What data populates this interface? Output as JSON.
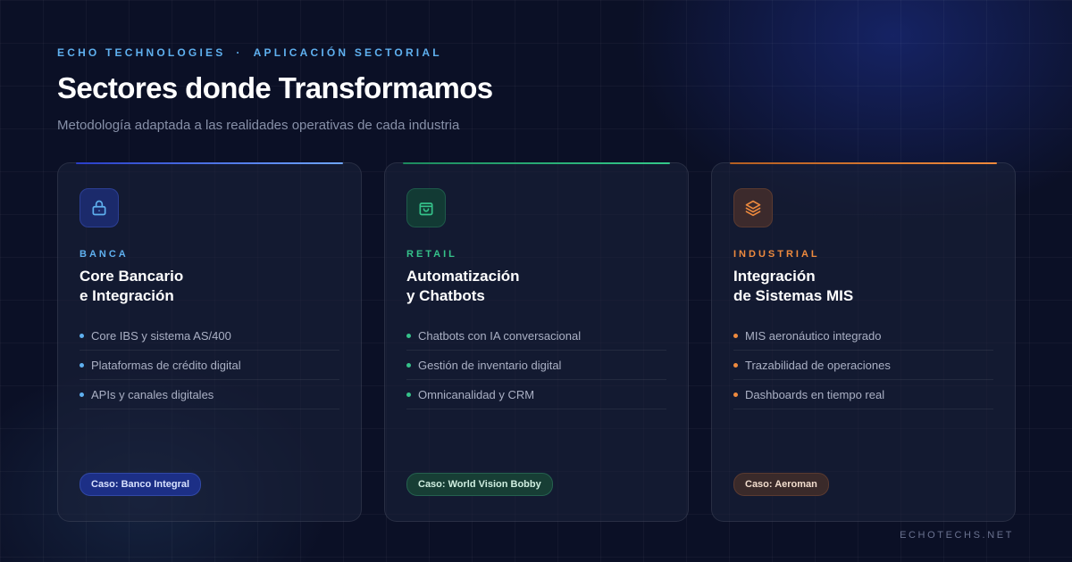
{
  "header": {
    "eyebrow_brand": "ECHO TECHNOLOGIES",
    "eyebrow_separator": "·",
    "eyebrow_section": "APLICACIÓN SECTORIAL",
    "title": "Sectores donde Transformamos",
    "subtitle": "Metodología adaptada a las realidades operativas de cada industria"
  },
  "colors": {
    "banca": "#5fb0ef",
    "retail": "#35c28a",
    "industrial": "#ee8a3e",
    "background": "#0b1026"
  },
  "cards": [
    {
      "icon": "lock-icon",
      "tag": "BANCA",
      "title_line1": "Core Bancario",
      "title_line2": "e Integración",
      "items": [
        "Core IBS y sistema AS/400",
        "Plataformas de crédito digital",
        "APIs y canales digitales"
      ],
      "badge": "Caso: Banco Integral"
    },
    {
      "icon": "shopping-bag-icon",
      "tag": "RETAIL",
      "title_line1": "Automatización",
      "title_line2": "y Chatbots",
      "items": [
        "Chatbots con IA conversacional",
        "Gestión de inventario digital",
        "Omnicanalidad y CRM"
      ],
      "badge": "Caso: World Vision Bobby"
    },
    {
      "icon": "layers-icon",
      "tag": "INDUSTRIAL",
      "title_line1": "Integración",
      "title_line2": "de Sistemas MIS",
      "items": [
        "MIS aeronáutico integrado",
        "Trazabilidad de operaciones",
        "Dashboards en tiempo real"
      ],
      "badge": "Caso: Aeroman"
    }
  ],
  "footer": {
    "site": "ECHOTECHS.NET"
  }
}
